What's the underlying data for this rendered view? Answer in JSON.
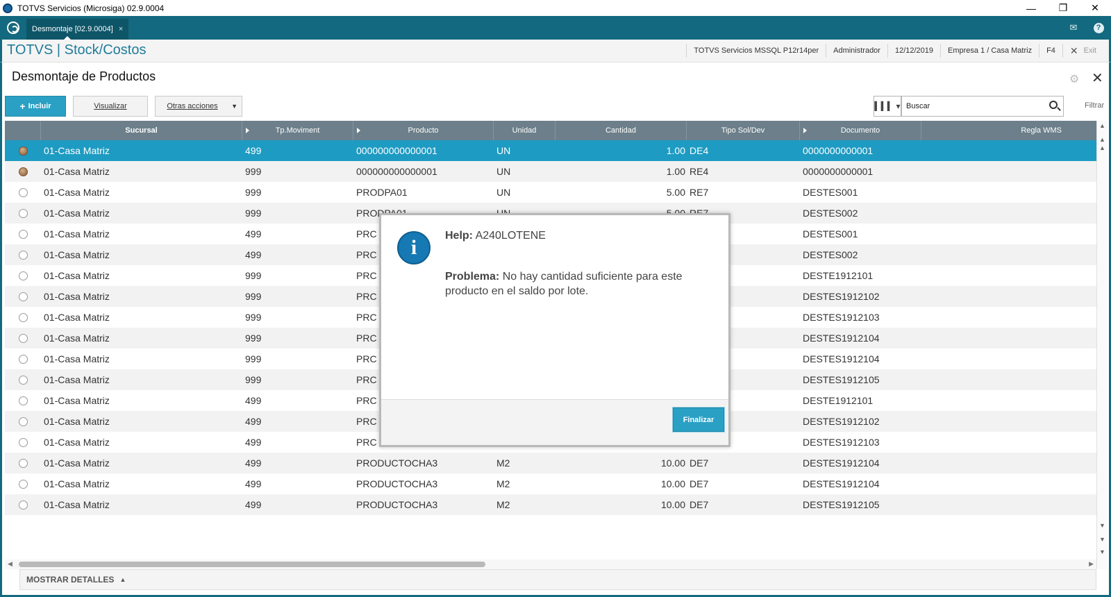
{
  "window": {
    "title": "TOTVS Servicios (Microsiga) 02.9.0004",
    "minimize": "—",
    "restore": "❐",
    "close": "✕"
  },
  "tabbar": {
    "tab_label": "Desmontaje [02.9.0004]",
    "tab_close": "×",
    "mail_icon": "✉",
    "help_icon": "?"
  },
  "module": {
    "title": "TOTVS | Stock/Costos",
    "env": "TOTVS Servicios MSSQL P12r14per",
    "user": "Administrador",
    "date": "12/12/2019",
    "company": "Empresa 1 / Casa Matriz",
    "key": "F4",
    "exit_x": "✕",
    "exit": "Exit"
  },
  "page": {
    "title": "Desmontaje de Productos",
    "close": "✕",
    "gear": "⚙"
  },
  "toolbar": {
    "incluir_plus": "+",
    "incluir": "Incluir",
    "visualizar": "Visualizar",
    "otras": "Otras acciones",
    "otras_caret": "▼",
    "columns_icon": "▍▍▍ ▾",
    "search_placeholder": "Buscar",
    "filtrar": "Filtrar"
  },
  "grid": {
    "columns": [
      "Sucursal",
      "Tp.Moviment",
      "Producto",
      "Unidad",
      "Cantidad",
      "Tipo Sol/Dev",
      "Documento",
      "Regla WMS"
    ],
    "rows": [
      {
        "led": "bar",
        "sucursal": "01-Casa Matriz",
        "tp": "499",
        "producto": "000000000000001",
        "unidad": "UN",
        "cantidad": "1.00",
        "tipo": "DE4",
        "documento": "0000000000001"
      },
      {
        "led": "bar",
        "sucursal": "01-Casa Matriz",
        "tp": "999",
        "producto": "000000000000001",
        "unidad": "UN",
        "cantidad": "1.00",
        "tipo": "RE4",
        "documento": "0000000000001"
      },
      {
        "led": "open",
        "sucursal": "01-Casa Matriz",
        "tp": "999",
        "producto": "PRODPA01",
        "unidad": "UN",
        "cantidad": "5.00",
        "tipo": "RE7",
        "documento": "DESTES001"
      },
      {
        "led": "open",
        "sucursal": "01-Casa Matriz",
        "tp": "999",
        "producto": "PRODPA01",
        "unidad": "UN",
        "cantidad": "5.00",
        "tipo": "RE7",
        "documento": "DESTES002"
      },
      {
        "led": "open",
        "sucursal": "01-Casa Matriz",
        "tp": "499",
        "producto": "PRC",
        "unidad": "",
        "cantidad": "",
        "tipo": "",
        "documento": "DESTES001"
      },
      {
        "led": "open",
        "sucursal": "01-Casa Matriz",
        "tp": "499",
        "producto": "PRC",
        "unidad": "",
        "cantidad": "",
        "tipo": "",
        "documento": "DESTES002"
      },
      {
        "led": "open",
        "sucursal": "01-Casa Matriz",
        "tp": "999",
        "producto": "PRC",
        "unidad": "",
        "cantidad": "",
        "tipo": "",
        "documento": "DESTE1912101"
      },
      {
        "led": "open",
        "sucursal": "01-Casa Matriz",
        "tp": "999",
        "producto": "PRC",
        "unidad": "",
        "cantidad": "",
        "tipo": "",
        "documento": "DESTES1912102"
      },
      {
        "led": "open",
        "sucursal": "01-Casa Matriz",
        "tp": "999",
        "producto": "PRC",
        "unidad": "",
        "cantidad": "",
        "tipo": "",
        "documento": "DESTES1912103"
      },
      {
        "led": "open",
        "sucursal": "01-Casa Matriz",
        "tp": "999",
        "producto": "PRC",
        "unidad": "",
        "cantidad": "",
        "tipo": "",
        "documento": "DESTES1912104"
      },
      {
        "led": "open",
        "sucursal": "01-Casa Matriz",
        "tp": "999",
        "producto": "PRC",
        "unidad": "",
        "cantidad": "",
        "tipo": "",
        "documento": "DESTES1912104"
      },
      {
        "led": "open",
        "sucursal": "01-Casa Matriz",
        "tp": "999",
        "producto": "PRC",
        "unidad": "",
        "cantidad": "",
        "tipo": "",
        "documento": "DESTES1912105"
      },
      {
        "led": "open",
        "sucursal": "01-Casa Matriz",
        "tp": "499",
        "producto": "PRC",
        "unidad": "",
        "cantidad": "",
        "tipo": "",
        "documento": "DESTE1912101"
      },
      {
        "led": "open",
        "sucursal": "01-Casa Matriz",
        "tp": "499",
        "producto": "PRC",
        "unidad": "",
        "cantidad": "",
        "tipo": "",
        "documento": "DESTES1912102"
      },
      {
        "led": "open",
        "sucursal": "01-Casa Matriz",
        "tp": "499",
        "producto": "PRC",
        "unidad": "",
        "cantidad": "",
        "tipo": "",
        "documento": "DESTES1912103"
      },
      {
        "led": "open",
        "sucursal": "01-Casa Matriz",
        "tp": "499",
        "producto": "PRODUCTOCHA3",
        "unidad": "M2",
        "cantidad": "10.00",
        "tipo": "DE7",
        "documento": "DESTES1912104"
      },
      {
        "led": "open",
        "sucursal": "01-Casa Matriz",
        "tp": "499",
        "producto": "PRODUCTOCHA3",
        "unidad": "M2",
        "cantidad": "10.00",
        "tipo": "DE7",
        "documento": "DESTES1912104"
      },
      {
        "led": "open",
        "sucursal": "01-Casa Matriz",
        "tp": "499",
        "producto": "PRODUCTOCHA3",
        "unidad": "M2",
        "cantidad": "10.00",
        "tipo": "DE7",
        "documento": "DESTES1912105"
      }
    ],
    "selected_row": 0
  },
  "footer": {
    "details": "MOSTRAR DETALLES",
    "details_icon": "▲"
  },
  "dialog": {
    "icon": "i",
    "title_label": "Help:",
    "title_code": "A240LOTENE",
    "problem_label": "Problema:",
    "problem_text": "No hay cantidad suficiente para este producto en el saldo por lote.",
    "button": "Finalizar"
  },
  "colors": {
    "teal": "#13697f",
    "accent": "#2aa0c4",
    "selected_row": "#1e9bc2",
    "header": "#6c7f8a"
  }
}
